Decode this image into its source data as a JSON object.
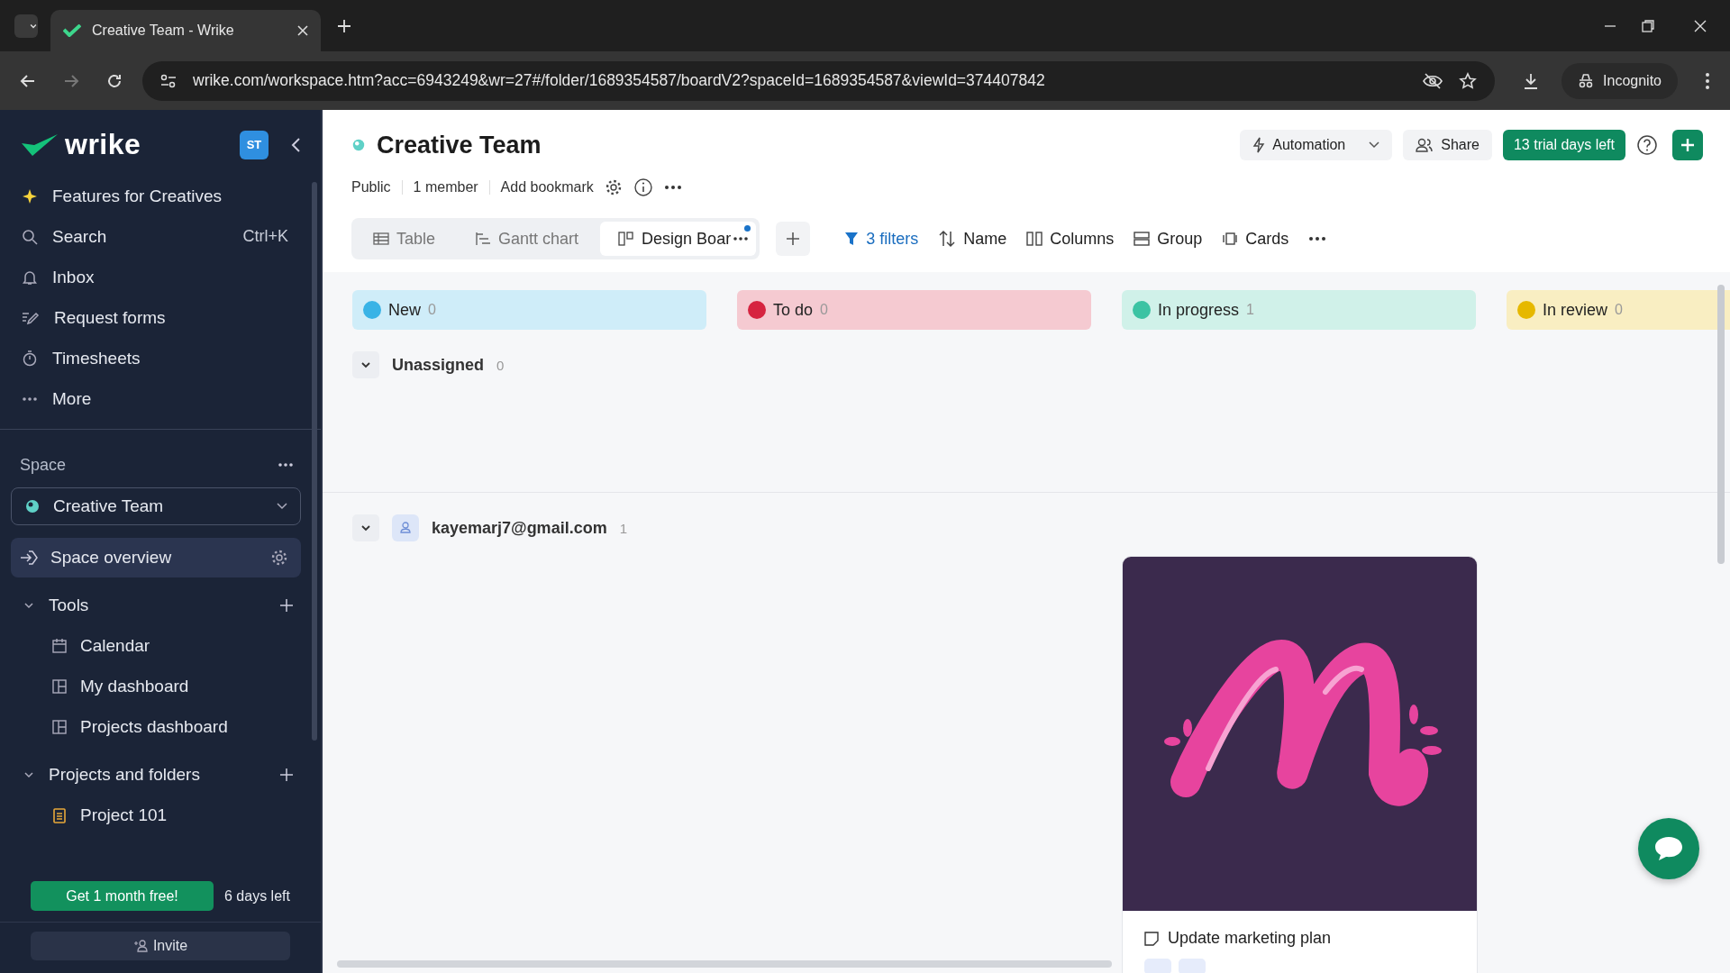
{
  "browser": {
    "tab_title": "Creative Team - Wrike",
    "url": "wrike.com/workspace.htm?acc=6943249&wr=27#/folder/1689354587/boardV2?spaceId=1689354587&viewId=374407842",
    "profile": "Incognito"
  },
  "sidebar": {
    "logo": "wrike",
    "avatar": "ST",
    "nav": [
      {
        "label": "Features for Creatives"
      },
      {
        "label": "Search",
        "shortcut": "Ctrl+K"
      },
      {
        "label": "Inbox"
      },
      {
        "label": "Request forms"
      },
      {
        "label": "Timesheets"
      },
      {
        "label": "More"
      }
    ],
    "space_heading": "Space",
    "space": "Creative Team",
    "space_overview": "Space overview",
    "sections": [
      {
        "label": "Tools",
        "expanded": true,
        "items": [
          "Calendar",
          "My dashboard",
          "Projects dashboard"
        ]
      },
      {
        "label": "Projects and folders",
        "expanded": true,
        "items": [
          "Project 101"
        ]
      }
    ],
    "promo_button": "Get 1 month free!",
    "promo_note": "6 days left",
    "invite": "Invite"
  },
  "header": {
    "title": "Creative Team",
    "meta": [
      "Public",
      "1 member",
      "Add bookmark"
    ],
    "automation": "Automation",
    "share": "Share",
    "trial": "13 trial days left"
  },
  "views": [
    {
      "label": "Table",
      "selected": false
    },
    {
      "label": "Gantt chart",
      "selected": false
    },
    {
      "label": "Design Boar",
      "selected": true
    }
  ],
  "toolbar": [
    {
      "label": "3 filters",
      "kind": "filter"
    },
    {
      "label": "Name",
      "kind": "sort"
    },
    {
      "label": "Columns",
      "kind": "columns"
    },
    {
      "label": "Group",
      "kind": "group"
    },
    {
      "label": "Cards",
      "kind": "cards"
    }
  ],
  "columns": [
    {
      "label": "New",
      "count": "0",
      "color": "#39b3e6"
    },
    {
      "label": "To do",
      "count": "0",
      "color": "#d62440"
    },
    {
      "label": "In progress",
      "count": "1",
      "color": "#3cc3a3",
      "cards": [
        {
          "title": "Update marketing plan",
          "kind": "picture"
        }
      ]
    },
    {
      "label": "In review",
      "count": "0",
      "color": "#e6b800"
    }
  ],
  "groups": [
    {
      "label": "Unassigned",
      "count": "0",
      "expanded": true,
      "avatar": false
    },
    {
      "label": "kayemarj7@gmail.com",
      "count": "1",
      "expanded": true,
      "avatar": true
    }
  ]
}
